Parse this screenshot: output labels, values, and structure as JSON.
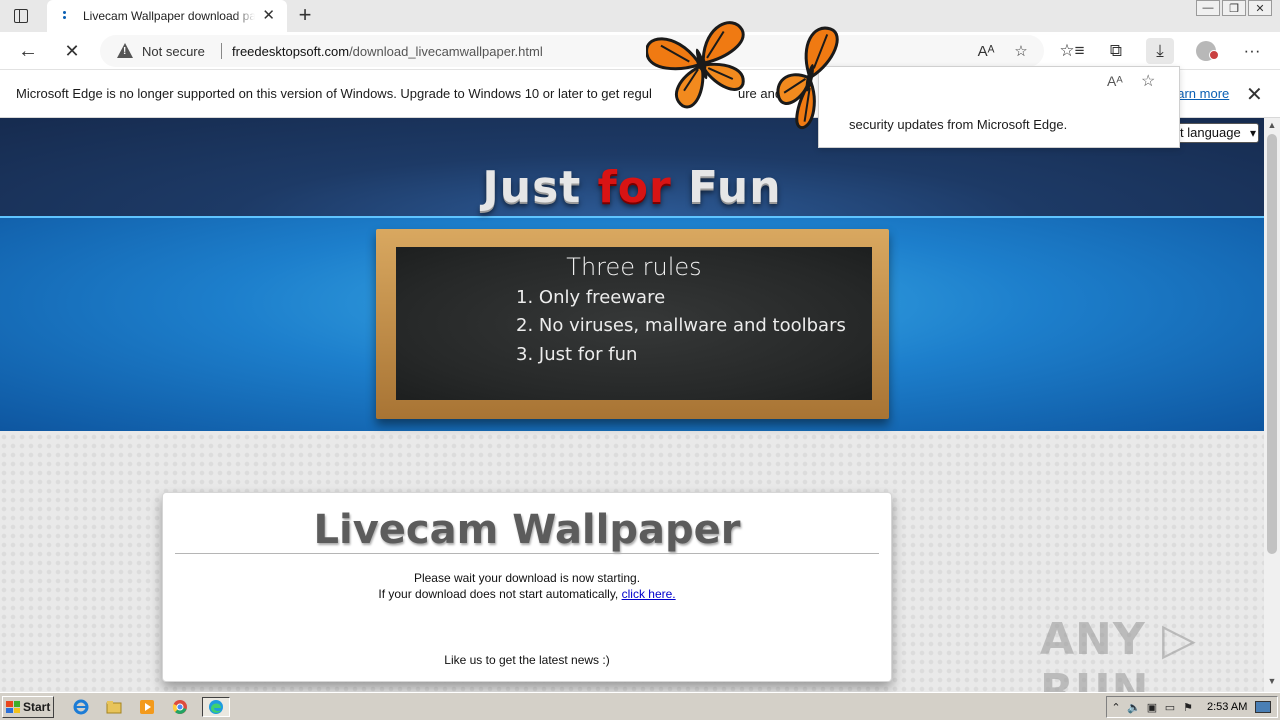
{
  "tab": {
    "title": "Livecam Wallpaper download page",
    "close": "✕"
  },
  "newtab": "+",
  "window_controls": {
    "minimize": "—",
    "maximize": "❐",
    "close": "✕"
  },
  "address": {
    "security_label": "Not secure",
    "url_host": "freedesktopsoft.com",
    "url_path": "/download_livecamwallpaper.html"
  },
  "nav": {
    "back": "←",
    "stop": "✕"
  },
  "toolbar_icons": {
    "read_aloud": "Aᴬ",
    "favorite_add": "☆",
    "favorites": "☆≡",
    "collections": "⧉",
    "downloads": "⤓",
    "more": "···"
  },
  "infobar": {
    "message": "Microsoft Edge is no longer supported on this version of Windows. Upgrade to Windows 10 or later to get regular feature and security updates from Microsoft Edge.",
    "visible_message": "Microsoft Edge is no longer supported on this version of Windows. Upgrade to Windows 10 or later to get regul",
    "mid_text": "ure and se",
    "learn_more": "earn more",
    "close": "✕"
  },
  "popup": {
    "text": "security updates from Microsoft Edge."
  },
  "page": {
    "logo": {
      "part1": "Just ",
      "part2": "for",
      "part3": " Fun"
    },
    "board": {
      "title": "Three rules",
      "rules": [
        "1. Only freeware",
        "2. No viruses, mallware and toolbars",
        "3. Just for fun"
      ]
    },
    "language_select": "t language",
    "card": {
      "title": "Livecam Wallpaper",
      "line1": "Please wait your download is now starting.",
      "line2": "If your download does not start automatically, ",
      "link": "click here.",
      "likes": "Like us to get the latest news :)"
    },
    "watermark": "ANY ▷ RUN"
  },
  "taskbar": {
    "start": "Start",
    "clock": "2:53 AM"
  },
  "colors": {
    "logo_red": "#d81414",
    "header_blue": "#1d7fcc",
    "link": "#0000cc",
    "butterfly_orange": "#f07a12"
  }
}
